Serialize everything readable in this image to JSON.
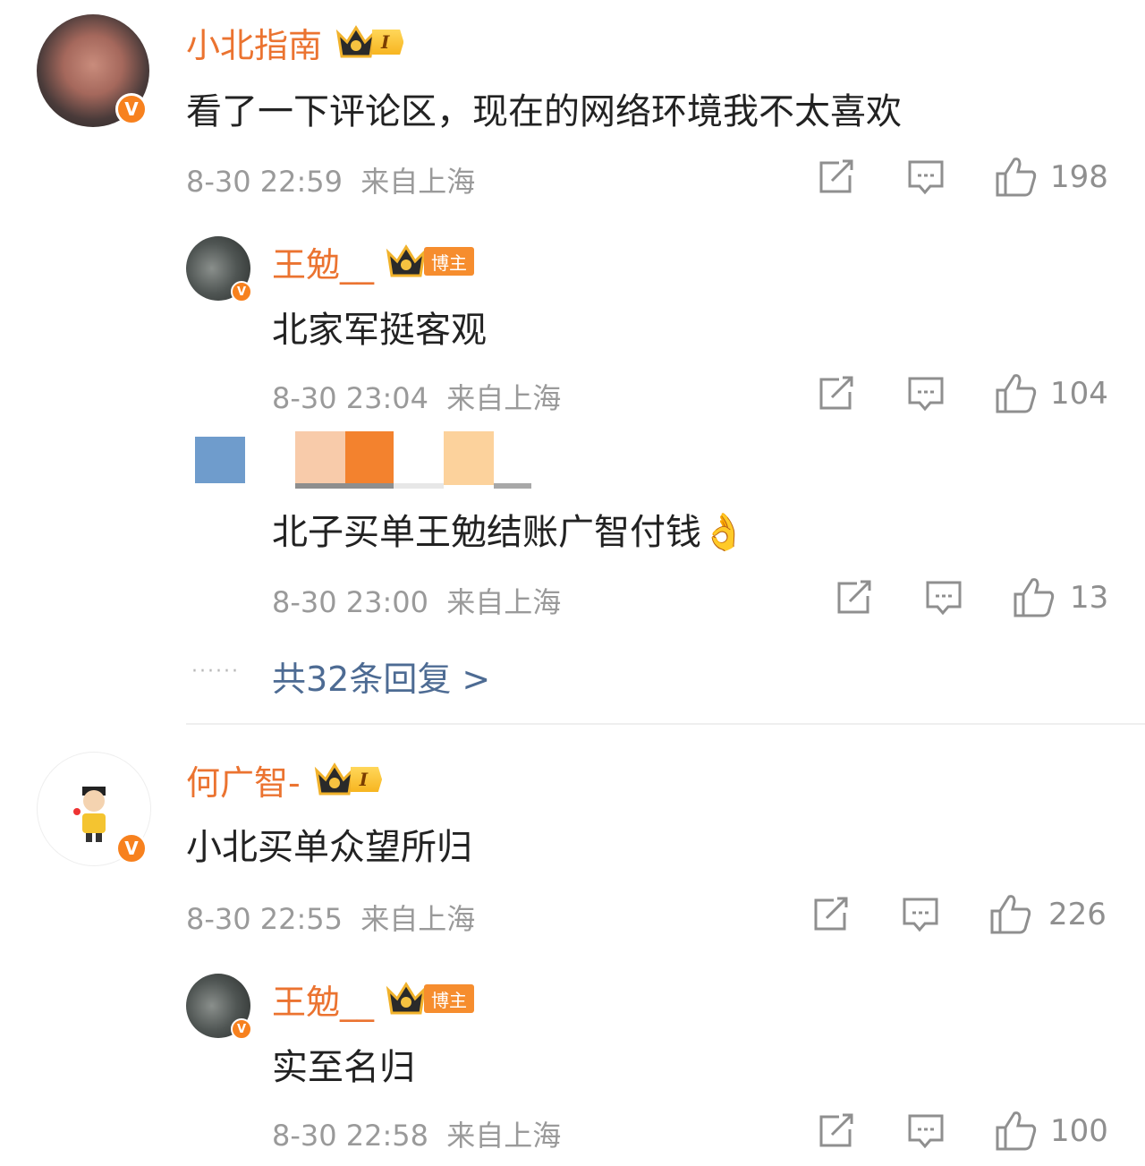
{
  "comments": [
    {
      "user": "小北指南",
      "level": "I",
      "text": "看了一下评论区，现在的网络环境我不太喜欢",
      "time": "8-30 22:59",
      "location": "来自上海",
      "likes": "198",
      "replies": [
        {
          "user": "王勉__",
          "badge": "博主",
          "text": "北家军挺客观",
          "time": "8-30 23:04",
          "location": "来自上海",
          "likes": "104"
        },
        {
          "user": "",
          "text": "北子买单王勉结账广智付钱",
          "emoji": "👌",
          "time": "8-30 23:00",
          "location": "来自上海",
          "likes": "13"
        }
      ],
      "more_replies": "共32条回复 >"
    },
    {
      "user": "何广智-",
      "level": "I",
      "text": "小北买单众望所归",
      "time": "8-30 22:55",
      "location": "来自上海",
      "likes": "226",
      "replies": [
        {
          "user": "王勉__",
          "badge": "博主",
          "text": "实至名归",
          "time": "8-30 22:58",
          "location": "来自上海",
          "likes": "100"
        }
      ]
    }
  ],
  "icons": {
    "verified": "v-badge-icon",
    "crown": "crown-icon",
    "share": "share-icon",
    "comment": "comment-icon",
    "like": "thumbs-up-icon",
    "verified_mark": "V"
  },
  "colors": {
    "username": "#eb7330",
    "meta": "#9a9a9a",
    "link": "#4d6b93",
    "badge": "#f7811e"
  }
}
